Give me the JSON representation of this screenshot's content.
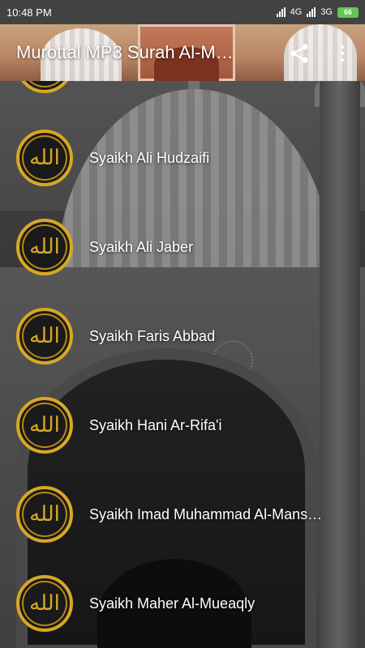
{
  "status": {
    "time": "10:48 PM",
    "net1": "4G",
    "net2": "3G",
    "battery": "66"
  },
  "toolbar": {
    "title": "Murottal MP3 Surah Al-M…"
  },
  "list": {
    "items": [
      {
        "label": ""
      },
      {
        "label": "Syaikh Ali Hudzaifi"
      },
      {
        "label": "Syaikh Ali Jaber"
      },
      {
        "label": "Syaikh Faris Abbad"
      },
      {
        "label": "Syaikh Hani Ar-Rifa'i"
      },
      {
        "label": "Syaikh Imad Muhammad Al-Mans…"
      },
      {
        "label": "Syaikh Maher Al-Mueaqly"
      }
    ],
    "avatar_glyph": "الله"
  },
  "colors": {
    "gold": "#d8a824",
    "toolbar": "#b98463"
  },
  "icons": {
    "share": "share-icon",
    "more": "more-vert-icon"
  }
}
